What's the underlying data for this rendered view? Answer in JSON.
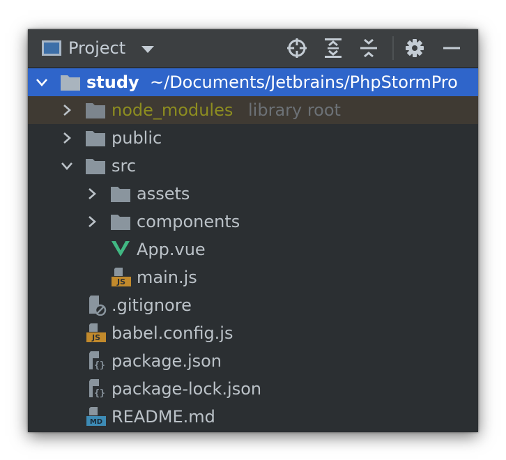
{
  "toolbar": {
    "title": "Project",
    "buttons": [
      "locate-icon",
      "expand-all-icon",
      "collapse-all-icon",
      "gear-icon",
      "minimize-icon"
    ]
  },
  "tree": {
    "root": {
      "name": "study",
      "path": "~/Documents/Jetbrains/PhpStormPro"
    },
    "node_modules": {
      "name": "node_modules",
      "note": "library root"
    },
    "public": {
      "name": "public"
    },
    "src": {
      "name": "src"
    },
    "assets": {
      "name": "assets"
    },
    "components": {
      "name": "components"
    },
    "app_vue": {
      "name": "App.vue"
    },
    "main_js": {
      "name": "main.js"
    },
    "gitignore": {
      "name": ".gitignore"
    },
    "babel_config": {
      "name": "babel.config.js"
    },
    "package_json": {
      "name": "package.json"
    },
    "package_lock": {
      "name": "package-lock.json"
    },
    "readme": {
      "name": "README.md"
    }
  },
  "colors": {
    "panel_bg": "#2b2f32",
    "toolbar_bg": "#3c3f41",
    "selection": "#2f65ca",
    "folder": "#8a959e",
    "library_text": "#8d8d20",
    "vue_green": "#41b883",
    "js_badge": "#c28a2c",
    "md_badge": "#3d8bb5"
  }
}
